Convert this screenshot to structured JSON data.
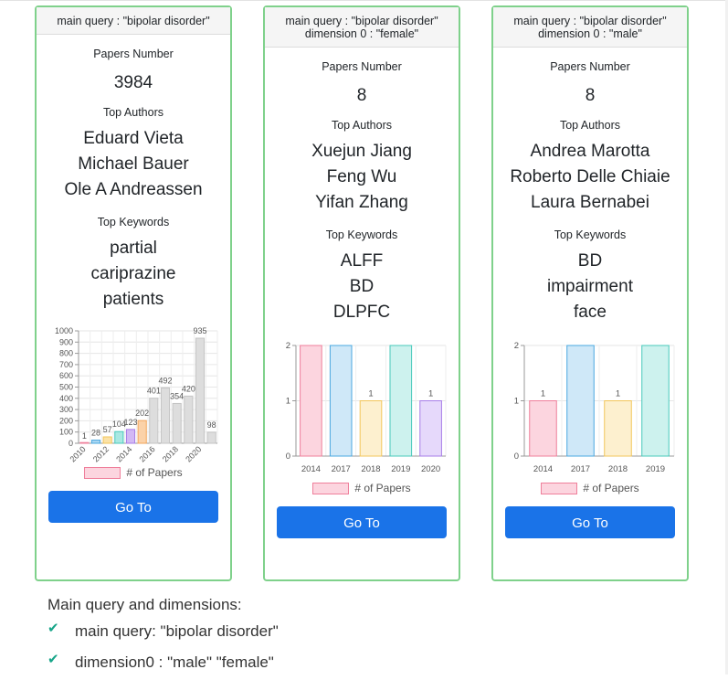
{
  "cards": [
    {
      "header_lines": [
        "main query : \"bipolar disorder\""
      ],
      "papers_label": "Papers Number",
      "papers_number": "3984",
      "authors_label": "Top Authors",
      "authors": [
        "Eduard Vieta",
        "Michael Bauer",
        "Ole A Andreassen"
      ],
      "keywords_label": "Top Keywords",
      "keywords": [
        "partial",
        "cariprazine",
        "patients"
      ],
      "legend_label": "# of Papers",
      "button_label": "Go To"
    },
    {
      "header_lines": [
        "main query : \"bipolar disorder\"",
        "dimension 0 : \"female\""
      ],
      "papers_label": "Papers Number",
      "papers_number": "8",
      "authors_label": "Top Authors",
      "authors": [
        "Xuejun Jiang",
        "Feng Wu",
        "Yifan Zhang"
      ],
      "keywords_label": "Top Keywords",
      "keywords": [
        "ALFF",
        "BD",
        "DLPFC"
      ],
      "legend_label": "# of Papers",
      "button_label": "Go To"
    },
    {
      "header_lines": [
        "main query : \"bipolar disorder\"",
        "dimension 0 : \"male\""
      ],
      "papers_label": "Papers Number",
      "papers_number": "8",
      "authors_label": "Top Authors",
      "authors": [
        "Andrea Marotta",
        "Roberto Delle Chiaie",
        "Laura Bernabei"
      ],
      "keywords_label": "Top Keywords",
      "keywords": [
        "BD",
        "impairment",
        "face"
      ],
      "legend_label": "# of Papers",
      "button_label": "Go To"
    }
  ],
  "chart_data": [
    {
      "type": "bar",
      "categories": [
        "2010",
        "2011",
        "2012",
        "2013",
        "2014",
        "2015",
        "2016",
        "2017",
        "2018",
        "2019",
        "2020",
        "2021"
      ],
      "tick_labels_shown": [
        "2010",
        "2012",
        "2014",
        "2016",
        "2018",
        "2020"
      ],
      "values": [
        1,
        28,
        57,
        104,
        123,
        202,
        401,
        492,
        354,
        420,
        935,
        98
      ],
      "value_labels": [
        "1",
        "28",
        "57",
        "104",
        "123",
        "202",
        "401",
        "492",
        "354",
        "420",
        "935",
        "98"
      ],
      "yticks": [
        0,
        100,
        200,
        300,
        400,
        500,
        600,
        700,
        800,
        900,
        1000
      ],
      "ylim": [
        0,
        1000
      ],
      "legend": "# of Papers",
      "colors": [
        "#f7b3c5",
        "#a9d7f2",
        "#fbe2a6",
        "#a9e8e2",
        "#d2b8f4",
        "#fbd2a9",
        "#dddddd",
        "#dddddd",
        "#dddddd",
        "#dddddd",
        "#dddddd",
        "#dddddd"
      ],
      "borders": [
        "#ef7f9b",
        "#4aa8e0",
        "#f2c65b",
        "#48c9bb",
        "#a77de8",
        "#f2a55b",
        "#c4c4c4",
        "#c4c4c4",
        "#c4c4c4",
        "#c4c4c4",
        "#c4c4c4",
        "#c4c4c4"
      ]
    },
    {
      "type": "bar",
      "categories": [
        "2014",
        "2017",
        "2018",
        "2019",
        "2020"
      ],
      "values": [
        2,
        2,
        1,
        2,
        1
      ],
      "value_labels": [
        "",
        "",
        "1",
        "",
        "1"
      ],
      "yticks": [
        0,
        1,
        2
      ],
      "ylim": [
        0,
        2
      ],
      "legend": "# of Papers",
      "colors": [
        "#fcd5df",
        "#cfe8f8",
        "#fdf0cf",
        "#cdf2ee",
        "#e6d9fb"
      ],
      "borders": [
        "#ef7f9b",
        "#4aa8e0",
        "#f2c65b",
        "#48c9bb",
        "#a77de8"
      ]
    },
    {
      "type": "bar",
      "categories": [
        "2014",
        "2017",
        "2018",
        "2019"
      ],
      "values": [
        1,
        2,
        1,
        2
      ],
      "value_labels": [
        "1",
        "",
        "1",
        ""
      ],
      "yticks": [
        0,
        1,
        2
      ],
      "ylim": [
        0,
        2
      ],
      "legend": "# of Papers",
      "colors": [
        "#fcd5df",
        "#cfe8f8",
        "#fdf0cf",
        "#cdf2ee"
      ],
      "borders": [
        "#ef7f9b",
        "#4aa8e0",
        "#f2c65b",
        "#48c9bb"
      ]
    }
  ],
  "summary": {
    "title": "Main query and dimensions:",
    "items": [
      "main query: \"bipolar disorder\"",
      "dimension0 : \"male\" \"female\""
    ],
    "check_icon": "checkmark-icon",
    "check_color": "#17a589"
  }
}
